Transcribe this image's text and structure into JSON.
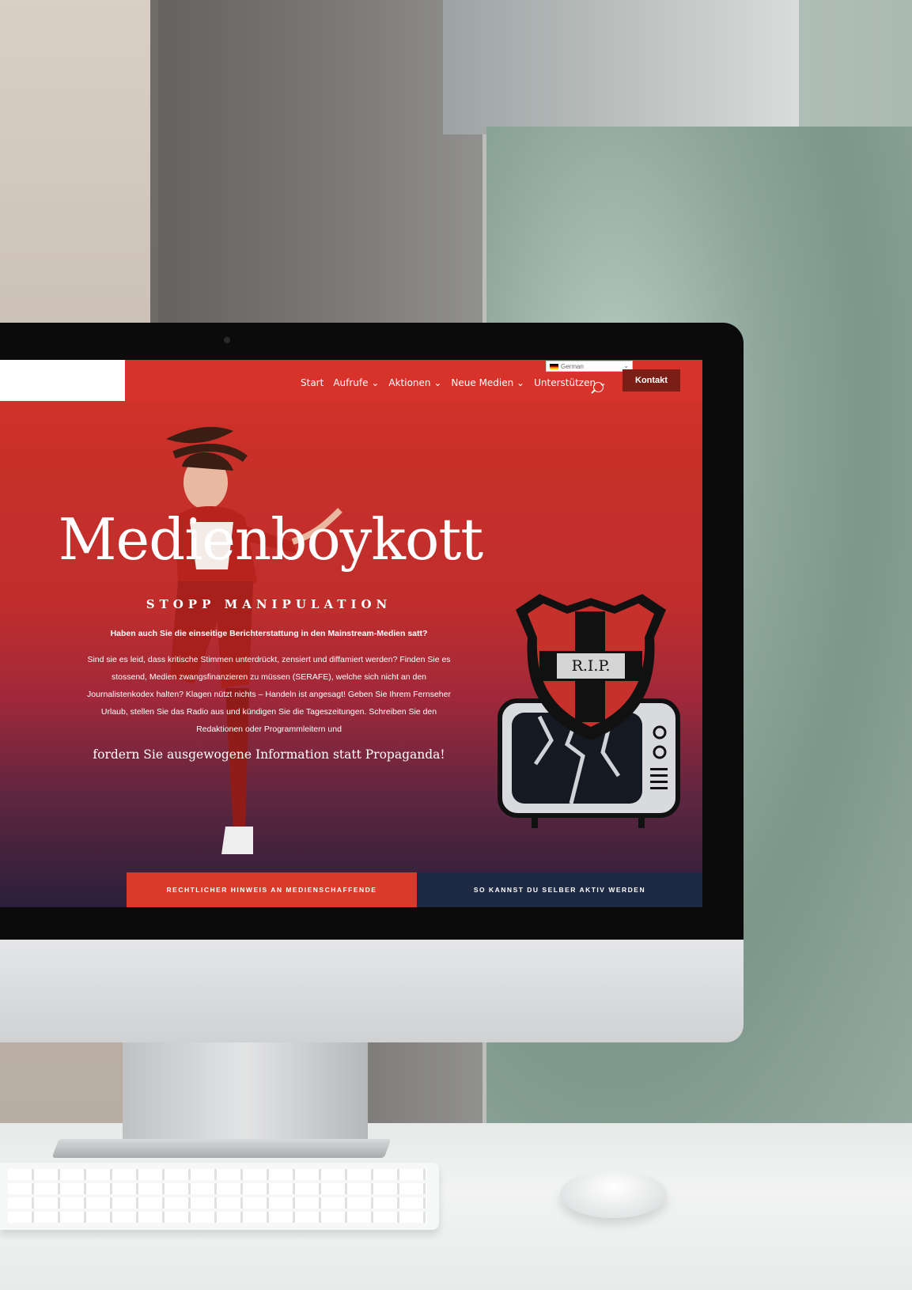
{
  "nav": {
    "items": [
      "Start",
      "Aufrufe ⌄",
      "Aktionen ⌄",
      "Neue Medien ⌄",
      "Unterstützen ⌄"
    ],
    "contact_label": "Kontakt",
    "language": "German"
  },
  "hero": {
    "title": "Medienboykott",
    "subtitle": "STOPP MANIPULATION",
    "question": "Haben auch Sie die einseitige Berichterstattung in den Mainstream-Medien satt?",
    "body": "Sind sie es leid, dass kritische Stimmen unterdrückt, zensiert und diffamiert werden? Finden Sie es stossend, Medien zwangsfinanzieren zu müssen (SERAFE), welche sich nicht an den Journalistenkodex halten? Klagen nützt nichts – Handeln ist angesagt! Geben Sie Ihrem Fernseher Urlaub, stellen Sie das Radio aus und kündigen Sie die Tageszeitungen. Schreiben Sie den Redaktionen oder Programmleitern und",
    "cta": "fordern Sie ausgewogene Information statt Propaganda!"
  },
  "badge": {
    "text": "R.I.P."
  },
  "buttons": {
    "legal_notice": "RECHTLICHER HINWEIS AN MEDIENSCHAFFENDE",
    "get_active": "SO KANNST DU SELBER AKTIV WERDEN"
  },
  "colors": {
    "brand_red": "#d8332a",
    "contact_bg": "#7a1e16",
    "navy": "#1e2a44"
  }
}
